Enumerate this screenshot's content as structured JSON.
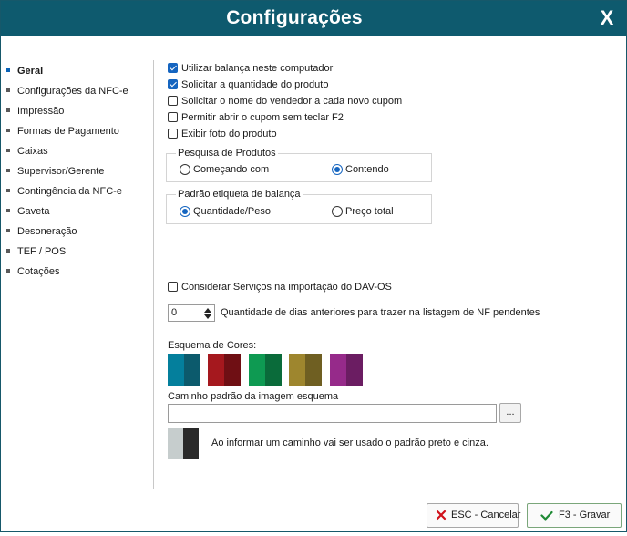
{
  "window": {
    "title": "Configurações",
    "close_label": "X"
  },
  "sidebar": {
    "items": [
      {
        "label": "Geral",
        "active": true
      },
      {
        "label": "Configurações da NFC-e"
      },
      {
        "label": "Impressão"
      },
      {
        "label": "Formas de Pagamento"
      },
      {
        "label": "Caixas"
      },
      {
        "label": "Supervisor/Gerente"
      },
      {
        "label": "Contingência da NFC-e"
      },
      {
        "label": "Gaveta"
      },
      {
        "label": "Desoneração"
      },
      {
        "label": "TEF / POS"
      },
      {
        "label": "Cotações"
      }
    ]
  },
  "options": [
    {
      "label": "Utilizar balança neste computador",
      "checked": true
    },
    {
      "label": "Solicitar a quantidade do produto",
      "checked": true
    },
    {
      "label": "Solicitar o nome do vendedor a cada novo cupom",
      "checked": false
    },
    {
      "label": "Permitir abrir o cupom sem teclar F2",
      "checked": false
    },
    {
      "label": "Exibir foto do produto",
      "checked": false
    }
  ],
  "product_search": {
    "legend": "Pesquisa de Produtos",
    "opt1": "Começando com",
    "opt2": "Contendo",
    "selected": "Contendo"
  },
  "scale_label": {
    "legend": "Padrão etiqueta de balança",
    "opt1": "Quantidade/Peso",
    "opt2": "Preço total",
    "selected": "Quantidade/Peso"
  },
  "services": {
    "label": "Considerar Serviços na importação do DAV-OS",
    "checked": false
  },
  "days": {
    "value": "0",
    "label": "Quantidade de dias anteriores para trazer na listagem de NF pendentes"
  },
  "color_schemes": {
    "label": "Esquema de Cores:",
    "swatches": [
      {
        "left": "#047f9c",
        "right": "#0c5a6c"
      },
      {
        "left": "#a5181e",
        "right": "#6f0f14"
      },
      {
        "left": "#0e9a52",
        "right": "#0a6b3a"
      },
      {
        "left": "#9e862e",
        "right": "#6f5f22"
      },
      {
        "left": "#962a8a",
        "right": "#6b1d62"
      }
    ]
  },
  "image_path": {
    "label": "Caminho padrão da imagem esquema",
    "value": "",
    "browse_label": "..."
  },
  "preview_note": "Ao informar um caminho vai ser usado o padrão preto e cinza.",
  "buttons": {
    "cancel": "ESC - Cancelar",
    "save": "F3 - Gravar"
  }
}
